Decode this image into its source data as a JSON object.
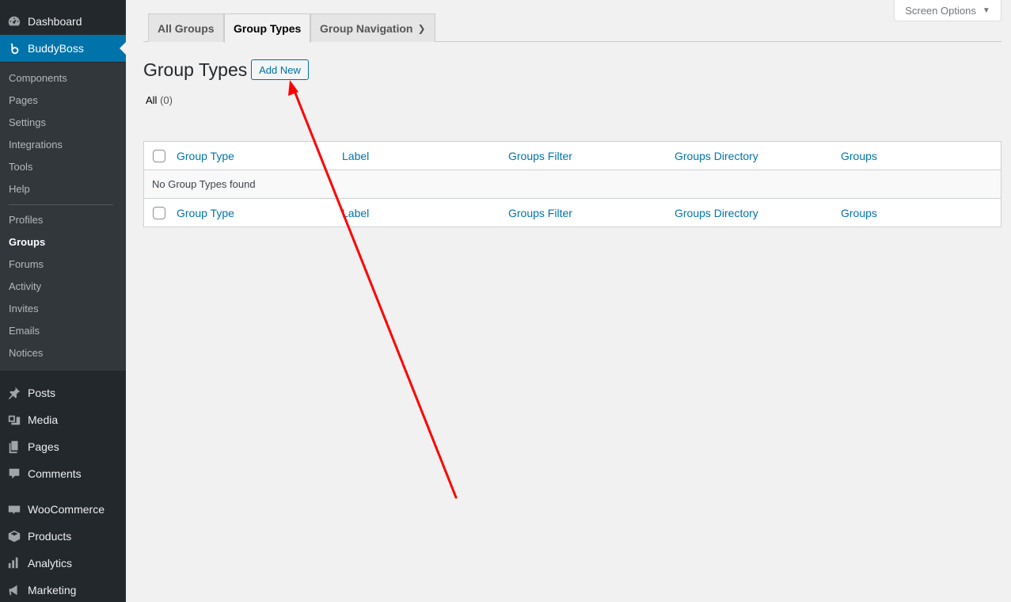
{
  "sidebar": {
    "top": [
      {
        "label": "Dashboard",
        "icon": "dashboard-icon"
      },
      {
        "label": "BuddyBoss",
        "icon": "buddyboss-icon"
      }
    ],
    "submenu": [
      "Components",
      "Pages",
      "Settings",
      "Integrations",
      "Tools",
      "Help",
      "Profiles",
      "Groups",
      "Forums",
      "Activity",
      "Invites",
      "Emails",
      "Notices"
    ],
    "bottom": [
      {
        "label": "Posts",
        "icon": "pin-icon"
      },
      {
        "label": "Media",
        "icon": "media-icon"
      },
      {
        "label": "Pages",
        "icon": "pages-icon"
      },
      {
        "label": "Comments",
        "icon": "comment-icon"
      },
      {
        "label": "WooCommerce",
        "icon": "woocommerce-icon"
      },
      {
        "label": "Products",
        "icon": "box-icon"
      },
      {
        "label": "Analytics",
        "icon": "bar-chart-icon"
      },
      {
        "label": "Marketing",
        "icon": "megaphone-icon"
      }
    ]
  },
  "tabs": [
    "All Groups",
    "Group Types",
    "Group Navigation"
  ],
  "screen_options": "Screen Options",
  "page": {
    "title": "Group Types",
    "add_new": "Add New",
    "filter_all": "All",
    "filter_count": "(0)"
  },
  "table": {
    "columns": [
      "Group Type",
      "Label",
      "Groups Filter",
      "Groups Directory",
      "Groups"
    ],
    "empty": "No Group Types found"
  },
  "colors": {
    "sidebar": "#23282d",
    "submenu": "#32373c",
    "accent": "#0073aa",
    "annotation": "#ff0000"
  }
}
